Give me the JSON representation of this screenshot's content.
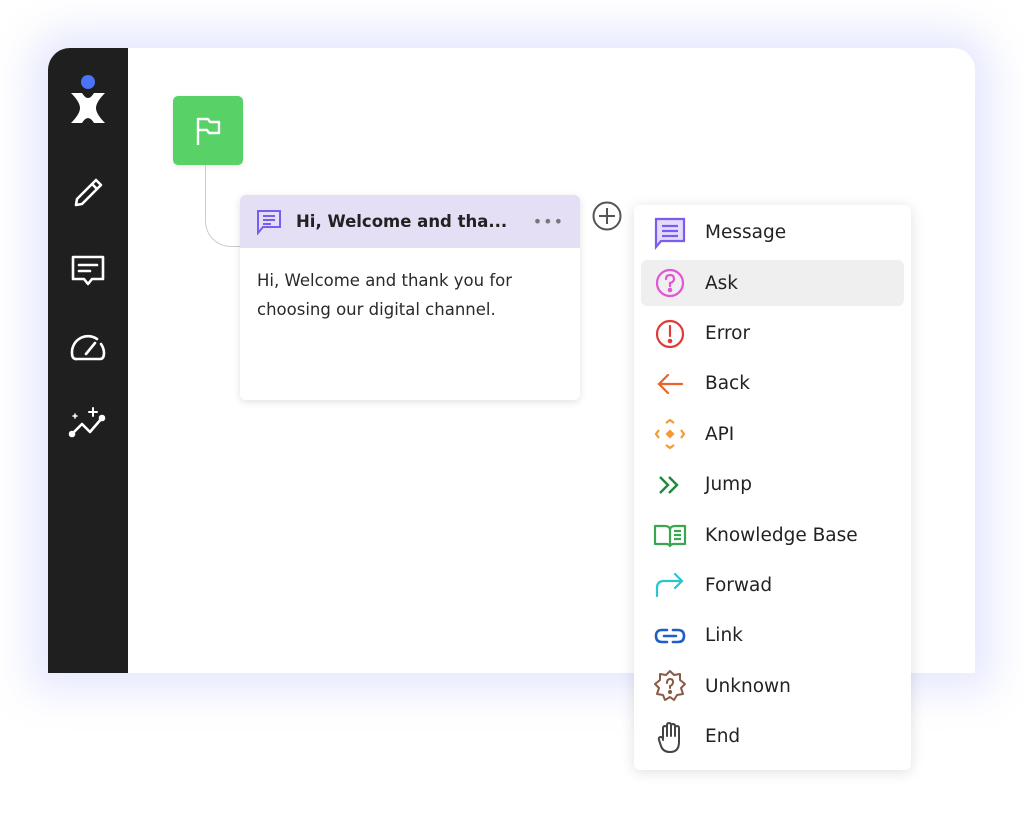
{
  "sidebar": {
    "items": [
      {
        "icon": "logo-icon",
        "name": "logo"
      },
      {
        "icon": "pencil-icon",
        "name": "edit"
      },
      {
        "icon": "message-icon",
        "name": "messages"
      },
      {
        "icon": "gauge-icon",
        "name": "dashboard"
      },
      {
        "icon": "sparkle-chart-icon",
        "name": "analytics"
      }
    ],
    "logo_dot_color": "#4a74f5"
  },
  "start_node": {
    "icon": "flag-icon",
    "color": "#58d167"
  },
  "card": {
    "title": "Hi, Welcome and tha...",
    "body": "Hi, Welcome and thank you for choosing our digital channel.",
    "more": "•••",
    "header_color": "#e4dff5"
  },
  "menu": {
    "items": [
      {
        "label": "Message",
        "icon": "message-icon",
        "color": "#7b5cf0"
      },
      {
        "label": "Ask",
        "icon": "question-circle-icon",
        "color": "#e056d6",
        "active": true
      },
      {
        "label": "Error",
        "icon": "exclamation-circle-icon",
        "color": "#e03a3a"
      },
      {
        "label": "Back",
        "icon": "arrow-left-icon",
        "color": "#e8652a"
      },
      {
        "label": "API",
        "icon": "api-icon",
        "color": "#f39a33"
      },
      {
        "label": "Jump",
        "icon": "double-chevron-icon",
        "color": "#1e8a3c"
      },
      {
        "label": "Knowledge Base",
        "icon": "book-icon",
        "color": "#3aa64f"
      },
      {
        "label": "Forwad",
        "icon": "forward-arrow-icon",
        "color": "#2cc4cf"
      },
      {
        "label": "Link",
        "icon": "link-icon",
        "color": "#1f5fc9"
      },
      {
        "label": "Unknown",
        "icon": "unknown-badge-icon",
        "color": "#8a5a44"
      },
      {
        "label": "End",
        "icon": "hand-icon",
        "color": "#444444"
      }
    ]
  }
}
